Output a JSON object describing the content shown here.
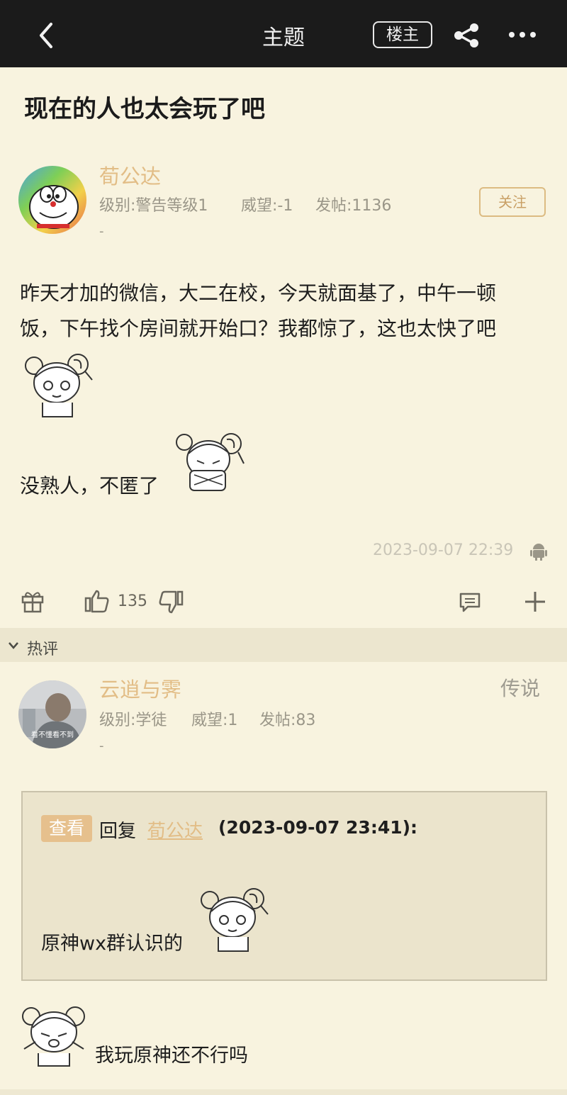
{
  "header": {
    "title": "主题",
    "owner_label": "楼主"
  },
  "post": {
    "title": "现在的人也太会玩了吧",
    "author": {
      "name": "荀公达",
      "level_text": "级别:警告等级1",
      "prestige_text": "威望:-1",
      "posts_text": "发帖:1136",
      "dash": "-"
    },
    "follow_label": "关注",
    "body_line1": "昨天才加的微信，大二在校，今天就面基了，中午一顿",
    "body_line2": "饭，下午找个房间就开始口？我都惊了，这也太快了吧",
    "body_line3": "没熟人，不匿了",
    "timestamp": "2023-09-07 22:39",
    "like_count": "135"
  },
  "hot_section": {
    "label": "热评"
  },
  "comment": {
    "author": {
      "name": "云逍与霁",
      "level_text": "级别:学徒",
      "prestige_text": "威望:1",
      "posts_text": "发帖:83",
      "dash": "-",
      "rank": "传说"
    },
    "avatar_text": "看不懂看不到",
    "quote": {
      "view_label": "查看",
      "reply_word": "回复",
      "reply_user": "荀公达",
      "reply_time": "(2023-09-07 23:41):",
      "text": "原神wx群认识的"
    },
    "text": "我玩原神还不行吗"
  },
  "colors": {
    "background": "#f8f3df",
    "topbar": "#1b1b1b",
    "accent_gold": "#e2bd86",
    "muted_gray": "#9a9688",
    "hot_bar": "#ece6cf"
  },
  "icons": [
    "back-arrow-icon",
    "share-icon",
    "more-icon",
    "gift-icon",
    "thumbs-up-icon",
    "thumbs-down-icon",
    "comment-icon",
    "plus-icon",
    "android-icon",
    "chevron-down-icon"
  ]
}
